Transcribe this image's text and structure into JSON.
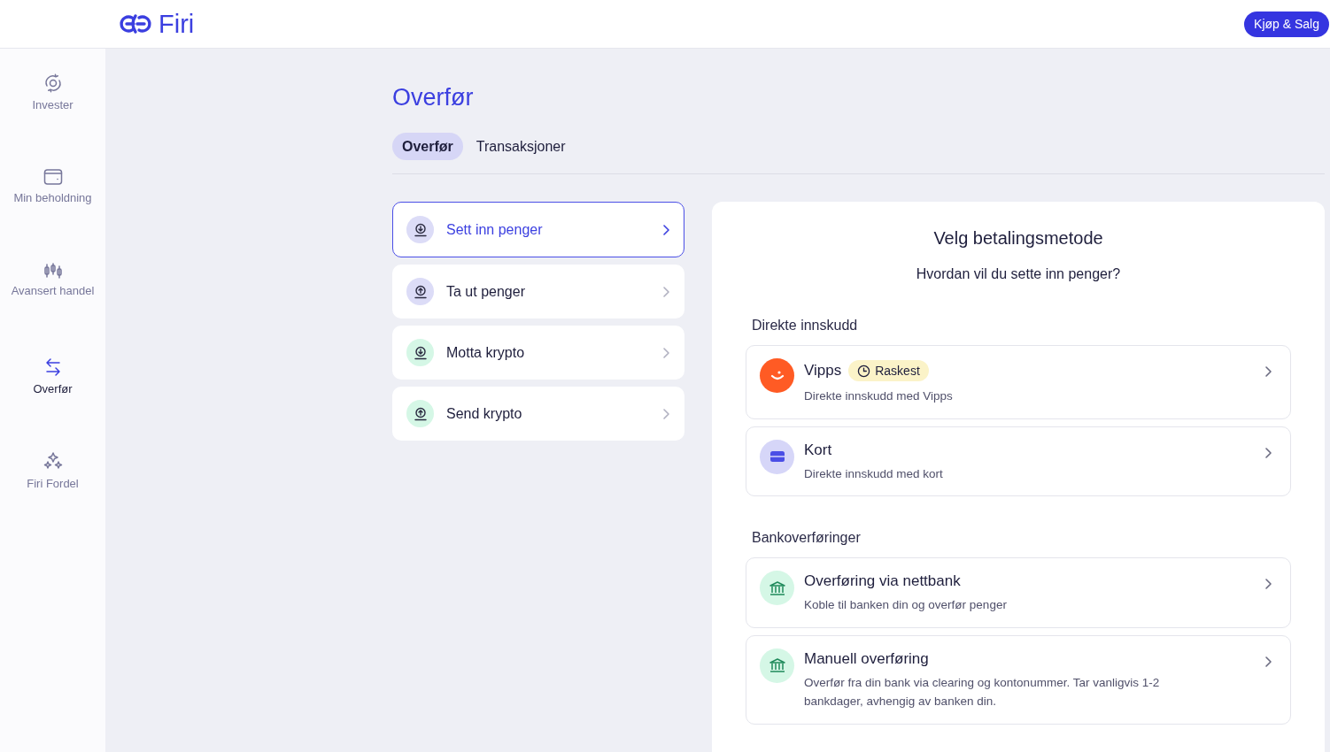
{
  "header": {
    "logo_text": "Firi",
    "action_button": "Kjøp & Salg"
  },
  "sidebar": {
    "items": [
      {
        "label": "Invester",
        "kind": "invest",
        "selected": false
      },
      {
        "label": "Min beholdning",
        "kind": "wallet",
        "selected": false
      },
      {
        "label": "Avansert handel",
        "kind": "candles",
        "selected": false
      },
      {
        "label": "Overfør",
        "kind": "transfer",
        "selected": true
      },
      {
        "label": "Firi Fordel",
        "kind": "sparkle",
        "selected": false
      }
    ]
  },
  "page": {
    "title": "Overfør",
    "tabs": [
      {
        "label": "Overfør",
        "selected": true
      },
      {
        "label": "Transaksjoner",
        "selected": false
      }
    ],
    "actions": [
      {
        "label": "Sett inn penger",
        "kind": "down",
        "color": "#dcdcf7",
        "selected": true
      },
      {
        "label": "Ta ut penger",
        "kind": "up",
        "color": "#dcdcf7",
        "selected": false
      },
      {
        "label": "Motta krypto",
        "kind": "down",
        "color": "#d5f7e6",
        "selected": false
      },
      {
        "label": "Send krypto",
        "kind": "up",
        "color": "#d5f7e6",
        "selected": false
      }
    ],
    "panel": {
      "title": "Velg betalingsmetode",
      "subtitle": "Hvordan vil du sette inn penger?",
      "sections": [
        {
          "heading": "Direkte innskudd",
          "methods": [
            {
              "title": "Vipps",
              "kind": "vipps",
              "badge": "Raskest",
              "description": "Direkte innskudd med Vipps"
            },
            {
              "title": "Kort",
              "kind": "card",
              "description": "Direkte innskudd med kort"
            }
          ]
        },
        {
          "heading": "Bankoverføringer",
          "methods": [
            {
              "title": "Overføring via nettbank",
              "kind": "bank",
              "description": "Koble til banken din og overfør penger"
            },
            {
              "title": "Manuell overføring",
              "kind": "bank",
              "description": "Overfør fra din bank via clearing og kontonummer. Tar vanligvis 1-2 bankdager, avhengig av banken din."
            }
          ]
        }
      ]
    }
  }
}
